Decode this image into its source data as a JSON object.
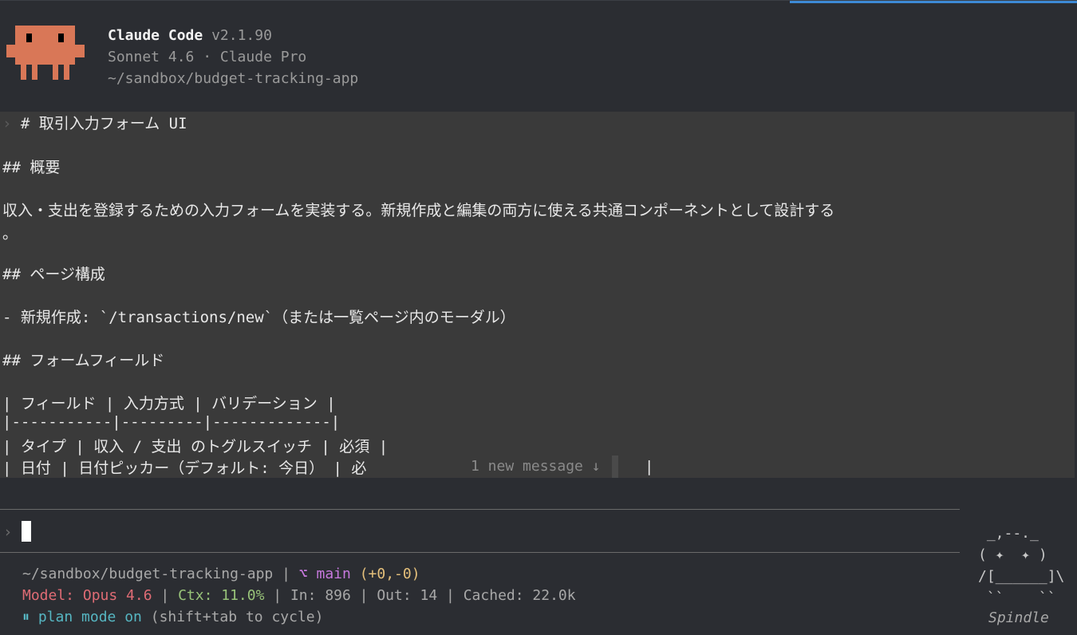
{
  "header": {
    "app_name": "Claude Code",
    "version": "v2.1.90",
    "model_line": "Sonnet 4.6 · Claude Pro",
    "path": "~/sandbox/budget-tracking-app"
  },
  "message": {
    "prompt_glyph": "›",
    "lines": [
      "# 取引入力フォーム UI",
      "## 概要",
      "収入・支出を登録するための入力フォームを実装する。新規作成と編集の両方に使える共通コンポーネントとして設計する",
      "。",
      "## ページ構成",
      "- 新規作成: `/transactions/new`（または一覧ページ内のモーダル）",
      "## フォームフィールド",
      "| フィールド | 入力方式 | バリデーション |",
      "|-----------|---------|-------------|",
      "| タイプ | 収入 / 支出 のトグルスイッチ | 必須 |",
      "| 日付 | 日付ピッカー（デフォルト: 今日） | 必",
      "|"
    ]
  },
  "new_message_indicator": "1 new message ↓",
  "input": {
    "prompt_glyph": "›"
  },
  "status": {
    "path": "~/sandbox/budget-tracking-app",
    "separator": " | ",
    "branch_icon": "⌥",
    "branch": "main",
    "diff": "(+0,-0)",
    "model_label": "Model: Opus 4.6",
    "ctx_label": "Ctx: 11.0%",
    "in_label": "In: 896",
    "out_label": "Out: 14",
    "cached_label": "Cached: 22.0k",
    "plan_icon": "⏸",
    "plan_label": "plan mode on",
    "plan_hint": "(shift+tab to cycle)"
  },
  "spindle": {
    "art": [
      " _,--._",
      "( ✦  ✦ )",
      "/[______]\\",
      " ``    ``"
    ],
    "name": "Spindle"
  },
  "colors": {
    "mascot": "#d97757",
    "accent": "#3d8ad6",
    "model": "#e06c75",
    "ctx": "#98c379",
    "branch": "#c679dd",
    "diff": "#e5c07b",
    "plan": "#56b6c2"
  }
}
